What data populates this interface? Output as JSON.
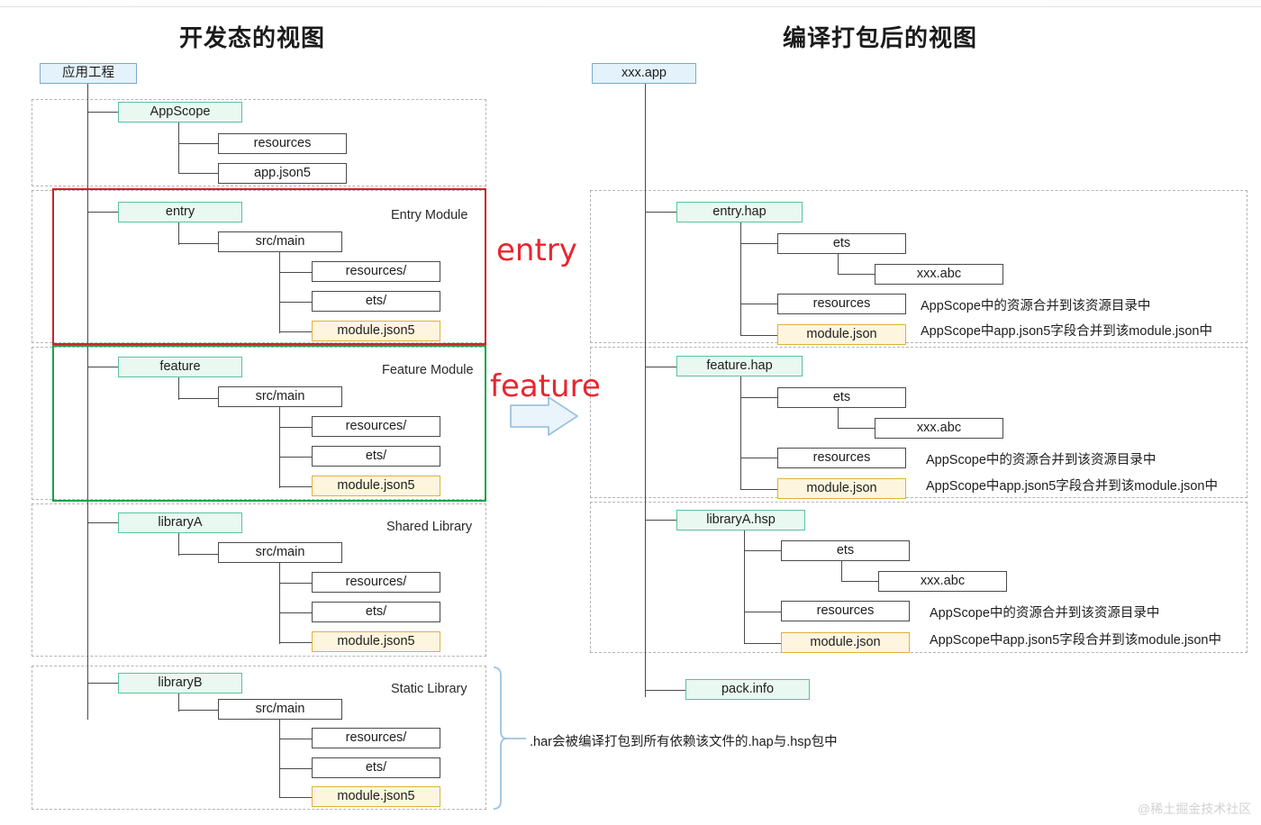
{
  "watermark": "@稀土掘金技术社区",
  "left_panel": {
    "title": "开发态的视图",
    "root": "应用工程",
    "groups": [
      {
        "key": "appscope",
        "label": "",
        "module": "AppScope",
        "children": [
          "resources",
          "app.json5"
        ]
      },
      {
        "key": "entry",
        "label": "Entry Module",
        "module": "entry",
        "src": "src/main",
        "children": [
          "resources/",
          "ets/",
          "module.json5"
        ]
      },
      {
        "key": "feature",
        "label": "Feature Module",
        "module": "feature",
        "src": "src/main",
        "children": [
          "resources/",
          "ets/",
          "module.json5"
        ]
      },
      {
        "key": "libraryA",
        "label": "Shared Library",
        "module": "libraryA",
        "src": "src/main",
        "children": [
          "resources/",
          "ets/",
          "module.json5"
        ]
      },
      {
        "key": "libraryB",
        "label": "Static Library",
        "module": "libraryB",
        "src": "src/main",
        "children": [
          "resources/",
          "ets/",
          "module.json5"
        ]
      }
    ],
    "har_note": ".har会被编译打包到所有依赖该文件的.hap与.hsp包中"
  },
  "right_panel": {
    "title": "编译打包后的视图",
    "root": "xxx.app",
    "groups": [
      {
        "key": "entry-hap",
        "package": "entry.hap",
        "ets": "ets",
        "abc": "xxx.abc",
        "resources": "resources",
        "json": "module.json",
        "note_resources": "AppScope中的资源合并到该资源目录中",
        "note_json": "AppScope中app.json5字段合并到该module.json中"
      },
      {
        "key": "feature-hap",
        "package": "feature.hap",
        "ets": "ets",
        "abc": "xxx.abc",
        "resources": "resources",
        "json": "module.json",
        "note_resources": "AppScope中的资源合并到该资源目录中",
        "note_json": "AppScope中app.json5字段合并到该module.json中"
      },
      {
        "key": "libraryA-hsp",
        "package": "libraryA.hsp",
        "ets": "ets",
        "abc": "xxx.abc",
        "resources": "resources",
        "json": "module.json",
        "note_resources": "AppScope中的资源合并到该资源目录中",
        "note_json": "AppScope中app.json5字段合并到该module.json中"
      }
    ],
    "pack_info": "pack.info"
  },
  "annotations": {
    "entry_label": "entry",
    "feature_label": "feature",
    "arrow": "right-arrow-icon"
  },
  "colors": {
    "root_fill": "#e4f2fb",
    "root_border": "#7aa9cf",
    "module_fill": "#e9f8f0",
    "module_border": "#57c3a0",
    "json_fill": "#fdf5de",
    "json_border": "#e0b13a",
    "plain_border": "#4a4a4a",
    "red_highlight": "#d3202a",
    "green_highlight": "#16a34a",
    "annotation_red": "#e8262f",
    "bracket_blue": "#9cc3e0"
  }
}
